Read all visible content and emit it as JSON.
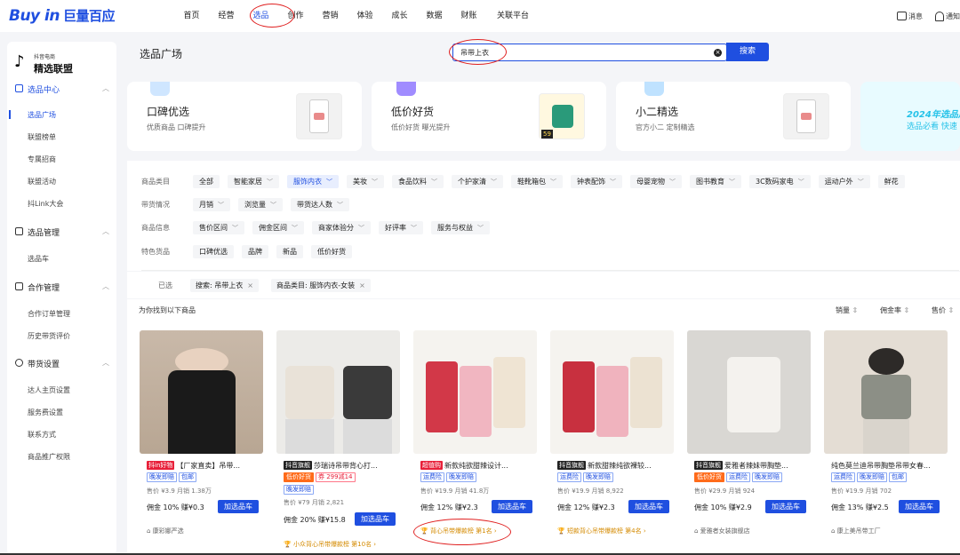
{
  "topbar": {
    "logo": "Buy in",
    "logo_cn": "巨量百应",
    "nav": [
      "首页",
      "经营",
      "选品",
      "创作",
      "营销",
      "体验",
      "成长",
      "数据",
      "财账",
      "关联平台"
    ],
    "active_nav": "选品",
    "msg": "消息",
    "notify": "通知"
  },
  "sidebar": {
    "brand_small": "抖音电商",
    "brand_large": "精选联盟",
    "sections": [
      {
        "label": "选品中心",
        "items": [
          "选品广场",
          "联盟榜单",
          "专属招商",
          "联盟活动",
          "抖Link大会"
        ]
      },
      {
        "label": "选品管理",
        "items": [
          "选品车"
        ]
      },
      {
        "label": "合作管理",
        "items": [
          "合作订单管理",
          "历史带货评价"
        ]
      },
      {
        "label": "带货设置",
        "items": [
          "达人主页设置",
          "服务费设置",
          "联系方式",
          "商品推广权限"
        ]
      }
    ]
  },
  "page_title": "选品广场",
  "search": {
    "value": "吊带上衣",
    "button": "搜索"
  },
  "cards": [
    {
      "title": "口碑优选",
      "sub": "优质商品 口碑提升"
    },
    {
      "title": "低价好货",
      "sub": "低价好货 曝光提升",
      "price_tag": "59"
    },
    {
      "title": "小二精选",
      "sub": "官方小二 定制精选"
    },
    {
      "title": "2024年选品广",
      "sub": "选品必看 快速"
    }
  ],
  "filters": {
    "category_label": "商品类目",
    "categories": [
      "全部",
      "智能家居",
      "服饰内衣",
      "美妆",
      "食品饮料",
      "个护家清",
      "鞋靴箱包",
      "钟表配饰",
      "母婴宠物",
      "图书教育",
      "3C数码家电",
      "运动户外",
      "鲜花"
    ],
    "active_category": "服饰内衣",
    "sales_label": "带货情况",
    "sales": [
      "月销",
      "浏览量",
      "带货达人数"
    ],
    "info_label": "商品信息",
    "info": [
      "售价区间",
      "佣金区间",
      "商家体验分",
      "好评率",
      "服务与权益"
    ],
    "feature_label": "特色货品",
    "features": [
      "口碑优选",
      "品牌",
      "新品",
      "低价好货"
    ]
  },
  "selected": {
    "label": "已选",
    "tags": [
      "搜索: 吊带上衣",
      "商品类目: 服饰内衣-女装"
    ]
  },
  "results": {
    "found_text": "为你找到以下商品",
    "sorts": [
      "销量",
      "佣金率",
      "售价"
    ]
  },
  "products": [
    {
      "badge": "抖in好物",
      "title": "【厂家直卖】吊带...",
      "tags": [
        "晚发即赔",
        "包邮"
      ],
      "tags2": [],
      "price": "售价 ¥3.9",
      "sales": "月销 1.38万",
      "commission": "佣金 10% 赚¥0.3",
      "add": "加选品车",
      "shop": "康彩娜严选",
      "rank": ""
    },
    {
      "badge": "抖音旗舰",
      "title": "莎瑞诗吊带背心打...",
      "tags": [
        "低价好货",
        "券 299减14"
      ],
      "tags2": [
        "晚发即赔"
      ],
      "price": "售价 ¥79",
      "sales": "月销 2,821",
      "commission": "佣金 20% 赚¥15.8",
      "add": "加选品车",
      "shop": "",
      "rank": "小众背心吊带爆款榜 第10名 ›"
    },
    {
      "badge": "超值购",
      "title": "新款纯欲甜辣设计...",
      "tags": [
        "运费险",
        "晚发即赔"
      ],
      "tags2": [],
      "price": "售价 ¥19.9",
      "sales": "月销 41.8万",
      "commission": "佣金 12% 赚¥2.3",
      "add": "加选品车",
      "shop": "",
      "rank": "背心吊带爆款榜 第1名 ›"
    },
    {
      "badge": "抖音旗舰",
      "title": "新款甜辣纯欲裸较...",
      "tags": [
        "运费险",
        "晚发即赔"
      ],
      "tags2": [],
      "price": "售价 ¥19.9",
      "sales": "月销 8,922",
      "commission": "佣金 12% 赚¥2.3",
      "add": "加选品车",
      "shop": "",
      "rank": "短款背心吊带爆款榜 第4名 ›"
    },
    {
      "badge": "抖音旗舰",
      "title": "爱雅者辣妹带胸垫...",
      "tags": [
        "低价好货",
        "运费险",
        "晚发即赔"
      ],
      "tags2": [],
      "price": "售价 ¥29.9",
      "sales": "月销 924",
      "commission": "佣金 10% 赚¥2.9",
      "add": "加选品车",
      "shop": "爱雅者女装旗舰店",
      "rank": ""
    },
    {
      "badge": "",
      "title": "纯色莫兰迪吊带胸垫吊带女春...",
      "tags": [
        "运费险",
        "晚发即赔",
        "包邮"
      ],
      "tags2": [],
      "price": "售价 ¥19.9",
      "sales": "月销 702",
      "commission": "佣金 13% 赚¥2.5",
      "add": "加选品车",
      "shop": "康上美吊带工厂",
      "rank": ""
    }
  ]
}
